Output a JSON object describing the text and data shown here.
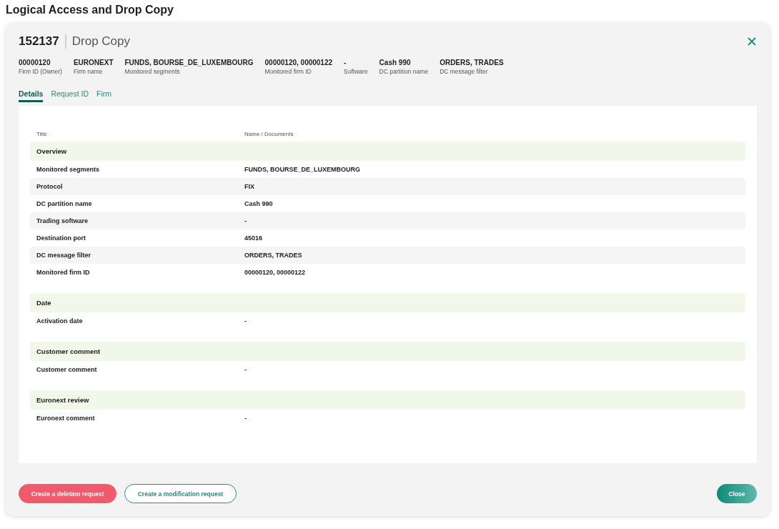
{
  "page_title": "Logical Access and Drop Copy",
  "dialog": {
    "id": "152137",
    "title": "Drop Copy"
  },
  "summary": [
    {
      "value": "00000120",
      "label": "Firm ID (Owner)"
    },
    {
      "value": "EURONEXT",
      "label": "Firm name"
    },
    {
      "value": "FUNDS, BOURSE_DE_LUXEMBOURG",
      "label": "Monitored segments"
    },
    {
      "value": "00000120, 00000122",
      "label": "Monitored firm ID"
    },
    {
      "value": "-",
      "label": "Software"
    },
    {
      "value": "Cash 990",
      "label": "DC partition name"
    },
    {
      "value": "ORDERS, TRADES",
      "label": "DC message filter"
    }
  ],
  "tabs": [
    {
      "label": "Details",
      "selected": true
    },
    {
      "label": "Request ID",
      "selected": false
    },
    {
      "label": "Firm",
      "selected": false
    }
  ],
  "table": {
    "columns": [
      "Title",
      "Name / Documents"
    ],
    "sections": [
      {
        "title": "Overview",
        "rows": [
          [
            "Monitored segments",
            "FUNDS, BOURSE_DE_LUXEMBOURG"
          ],
          [
            "Protocol",
            "FIX"
          ],
          [
            "DC partition name",
            "Cash 990"
          ],
          [
            "Trading software",
            "-"
          ],
          [
            "Destination port",
            "45016"
          ],
          [
            "DC message filter",
            "ORDERS, TRADES"
          ],
          [
            "Monitored firm ID",
            "00000120, 00000122"
          ]
        ]
      },
      {
        "title": "Date",
        "rows": [
          [
            "Activation date",
            "-"
          ]
        ]
      },
      {
        "title": "Customer comment",
        "rows": [
          [
            "Customer comment",
            "-"
          ]
        ]
      },
      {
        "title": "Euronext review",
        "rows": [
          [
            "Euronext comment",
            "-"
          ]
        ]
      }
    ]
  },
  "buttons": [
    {
      "label": "Create a deletion request",
      "kind": "danger"
    },
    {
      "label": "Create a modification request",
      "kind": "outline"
    },
    {
      "label": "Close",
      "kind": "primary"
    }
  ]
}
